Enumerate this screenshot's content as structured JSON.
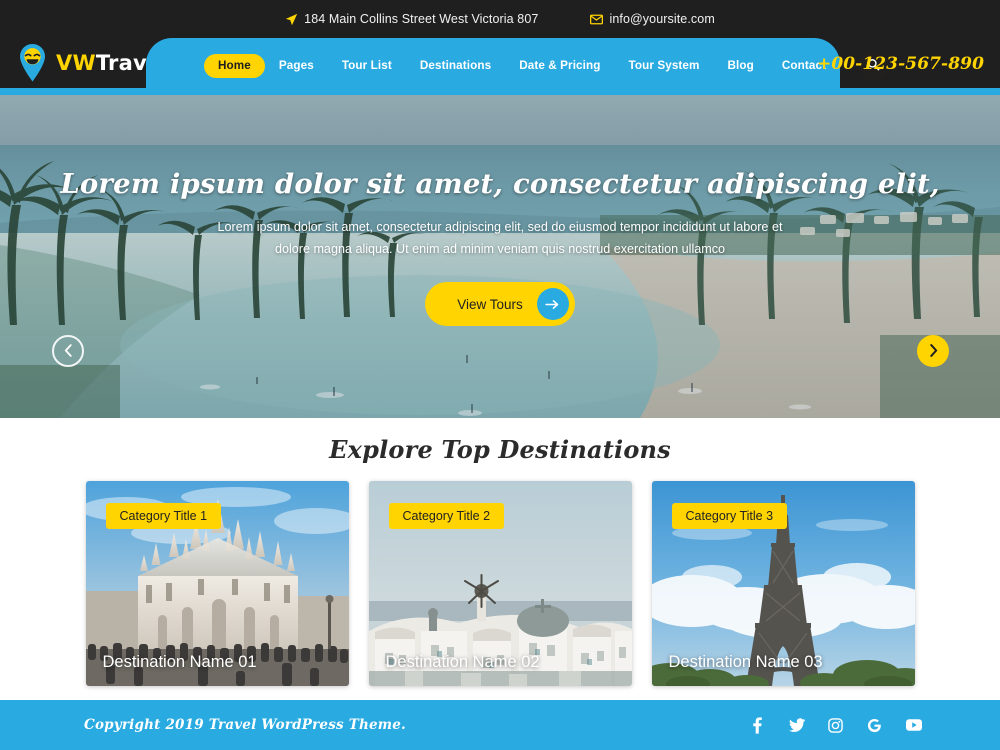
{
  "topbar": {
    "address": "184 Main Collins Street West Victoria 807",
    "address_icon": "location-arrow-icon",
    "email": "info@yoursite.com",
    "email_icon": "envelope-icon"
  },
  "header": {
    "logo": {
      "mark_icon": "map-pin-smiley-icon",
      "name_accent": "VW",
      "name_rest": "Travel"
    },
    "phone": "+00-123-567-890",
    "search_icon": "search-icon",
    "menu": [
      {
        "label": "Home",
        "active": true
      },
      {
        "label": "Pages",
        "active": false
      },
      {
        "label": "Tour List",
        "active": false
      },
      {
        "label": "Destinations",
        "active": false
      },
      {
        "label": "Date & Pricing",
        "active": false
      },
      {
        "label": "Tour System",
        "active": false
      },
      {
        "label": "Blog",
        "active": false
      },
      {
        "label": "Contact",
        "active": false
      }
    ]
  },
  "hero": {
    "title": "Lorem ipsum dolor sit amet, consectetur adipiscing elit,",
    "subtitle": "Lorem ipsum dolor sit amet, consectetur adipiscing elit, sed do eiusmod tempor incididunt ut labore et dolore magna aliqua. Ut enim ad minim veniam quis nostrud exercitation ullamco",
    "cta_label": "View Tours",
    "cta_arrow_icon": "arrow-right-icon",
    "prev_icon": "chevron-left-icon",
    "next_icon": "chevron-right-icon"
  },
  "destinations": {
    "heading": "Explore Top Destinations",
    "cards": [
      {
        "badge": "Category Title 1",
        "name": "Destination Name 01",
        "image": "milan-cathedral-photo"
      },
      {
        "badge": "Category Title 2",
        "name": "Destination Name 02",
        "image": "santorini-village-photo"
      },
      {
        "badge": "Category Title 3",
        "name": "Destination Name 03",
        "image": "eiffel-tower-photo"
      }
    ]
  },
  "footer": {
    "copyright": "Copyright 2019 Travel WordPress Theme.",
    "socials": [
      {
        "name": "facebook-icon"
      },
      {
        "name": "twitter-icon"
      },
      {
        "name": "instagram-icon"
      },
      {
        "name": "google-icon"
      },
      {
        "name": "youtube-icon"
      }
    ]
  },
  "colors": {
    "brand_blue": "#29abe2",
    "accent_yellow": "#ffd400",
    "dark": "#1f1f1f"
  }
}
